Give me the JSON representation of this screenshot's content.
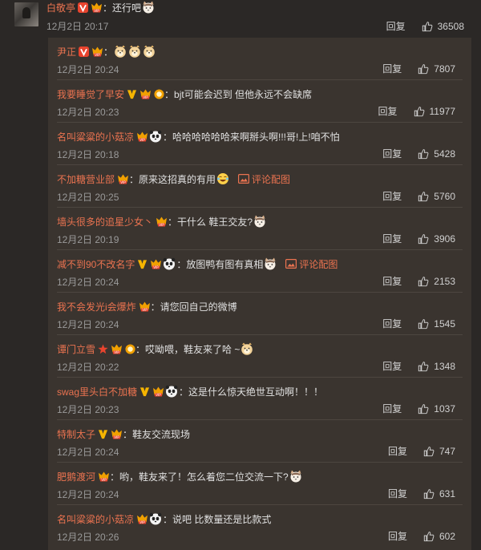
{
  "top_comment": {
    "user": "白敬亭",
    "text": "：还行吧",
    "date": "12月2日 20:17",
    "reply_label": "回复",
    "likes": "36508"
  },
  "replies": [
    {
      "user": "尹正",
      "text": "：",
      "date": "12月2日 20:24",
      "reply_label": "回复",
      "likes": "7807"
    },
    {
      "user": "我要睡觉了早安",
      "text": "：bjt可能会迟到 但他永远不会缺席",
      "date": "12月2日 20:23",
      "reply_label": "回复",
      "likes": "11977"
    },
    {
      "user": "名叫粱粱的小菇凉",
      "text": "：哈哈哈哈哈哈来啊掰头啊!!!哥!上!咱不怕",
      "date": "12月2日 20:18",
      "reply_label": "回复",
      "likes": "5428"
    },
    {
      "user": "不加糖营业部",
      "text": "：原来这招真的有用",
      "extra": "评论配图",
      "date": "12月2日 20:25",
      "reply_label": "回复",
      "likes": "5760"
    },
    {
      "user": "墙头很多的追星少女丶",
      "text": "：干什么 鞋王交友?",
      "date": "12月2日 20:19",
      "reply_label": "回复",
      "likes": "3906"
    },
    {
      "user": "减不到90不改名字",
      "text": "：放图鸭有图有真相",
      "extra": "评论配图",
      "date": "12月2日 20:24",
      "reply_label": "回复",
      "likes": "2153"
    },
    {
      "user": "我不会发光i会爆炸",
      "text": "：请您回自己的微博",
      "date": "12月2日 20:24",
      "reply_label": "回复",
      "likes": "1545"
    },
    {
      "user": "谭门立雪",
      "text": "：哎呦喂，鞋友来了哈 ~",
      "date": "12月2日 20:22",
      "reply_label": "回复",
      "likes": "1348"
    },
    {
      "user": "swag里头白不加糖",
      "text": "：这是什么惊天绝世互动啊！！！",
      "date": "12月2日 20:23",
      "reply_label": "回复",
      "likes": "1037"
    },
    {
      "user": "特制太子",
      "text": "：鞋友交流现场",
      "date": "12月2日 20:24",
      "reply_label": "回复",
      "likes": "747"
    },
    {
      "user": "肥鹅渡河",
      "text": "：哟，鞋友来了！怎么着您二位交流一下?",
      "date": "12月2日 20:24",
      "reply_label": "回复",
      "likes": "631"
    },
    {
      "user": "名叫粱粱的小菇凉",
      "text": "：说吧 比数量还是比款式",
      "date": "12月2日 20:26",
      "reply_label": "回复",
      "likes": "602"
    }
  ],
  "colors": {
    "page_bg": "#2b2826",
    "panel_bg": "#3a342f",
    "username": "#eb7350",
    "vip_badge": "#f0a000",
    "v_badge": "#f5b400",
    "red_v_badge": "#e8442e"
  }
}
